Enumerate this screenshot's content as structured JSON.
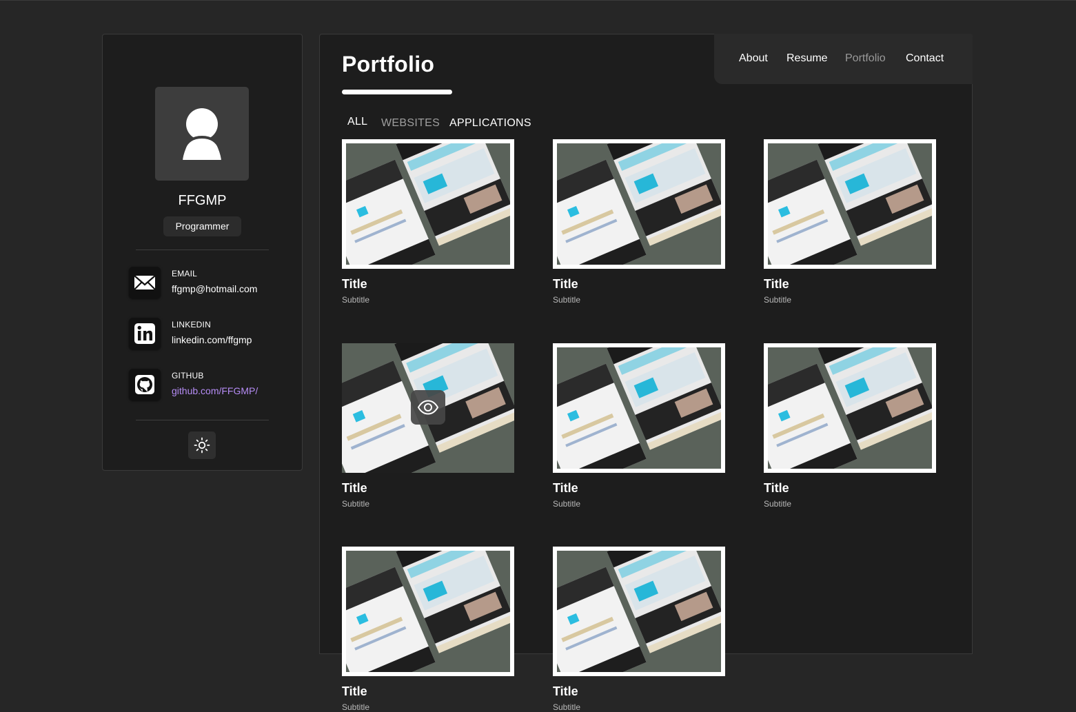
{
  "profile": {
    "name": "FFGMP",
    "role": "Programmer"
  },
  "contacts": [
    {
      "label": "EMAIL",
      "value": "ffgmp@hotmail.com",
      "icon": "mail-icon"
    },
    {
      "label": "LINKEDIN",
      "value": "linkedin.com/ffgmp",
      "icon": "linkedin-icon"
    },
    {
      "label": "GITHUB",
      "value": "github.com/FFGMP/",
      "icon": "github-icon"
    }
  ],
  "nav": {
    "items": [
      "About",
      "Resume",
      "Portfolio",
      "Contact"
    ],
    "active": "Portfolio"
  },
  "page": {
    "title": "Portfolio"
  },
  "filters": {
    "items": [
      "ALL",
      "WEBSITES",
      "APPLICATIONS"
    ],
    "active": "ALL"
  },
  "projects": [
    {
      "title": "Title",
      "subtitle": "Subtitle"
    },
    {
      "title": "Title",
      "subtitle": "Subtitle"
    },
    {
      "title": "Title",
      "subtitle": "Subtitle"
    },
    {
      "title": "Title",
      "subtitle": "Subtitle"
    },
    {
      "title": "Title",
      "subtitle": "Subtitle"
    },
    {
      "title": "Title",
      "subtitle": "Subtitle"
    },
    {
      "title": "Title",
      "subtitle": "Subtitle"
    },
    {
      "title": "Title",
      "subtitle": "Subtitle"
    }
  ],
  "colors": {
    "background": "#262626",
    "panel": "#1d1d1d",
    "link_accent": "#b58cf5"
  }
}
